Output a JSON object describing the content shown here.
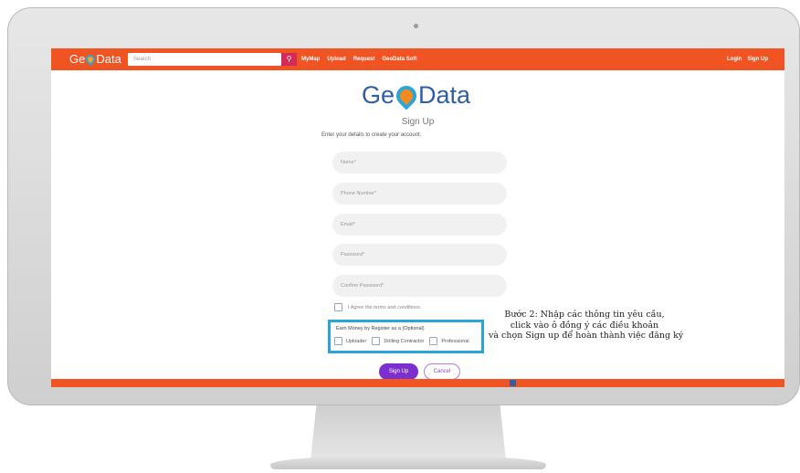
{
  "navbar": {
    "logo": "GeoData",
    "search_placeholder": "Search",
    "search_icon": "search-icon",
    "links": [
      "MyMap",
      "Upload",
      "Request",
      "GeoData Soft"
    ],
    "login": "Login",
    "signup": "Sign Up"
  },
  "brand": {
    "left": "Ge",
    "right": "Data"
  },
  "form": {
    "title": "Sign Up",
    "subtitle": "Enter your details to create your account:",
    "name_placeholder": "Name*",
    "phone_placeholder": "Phone Number*",
    "email_placeholder": "Email*",
    "password_placeholder": "Password*",
    "confirm_placeholder": "Confirm Password*",
    "agree_label": "I Agree the terms and conditions.",
    "earn_title": "Earn Money by Register as a (Optional)",
    "options": [
      "Uploader",
      "Drilling Contractor",
      "Professional"
    ],
    "signup_button": "Sign Up",
    "cancel_button": "Cancel"
  },
  "annotation": {
    "lines": [
      "Bước 2: Nhập các thông tin yêu cầu,",
      "click vào ô đồng ý các điều khoản",
      "và chọn Sign up để hoàn thành việc đăng ký"
    ]
  },
  "colors": {
    "navbar": "#f05423",
    "brand": "#2e5fa8",
    "highlight": "#2aa5d8",
    "primary_button": "#7c2fcf"
  }
}
